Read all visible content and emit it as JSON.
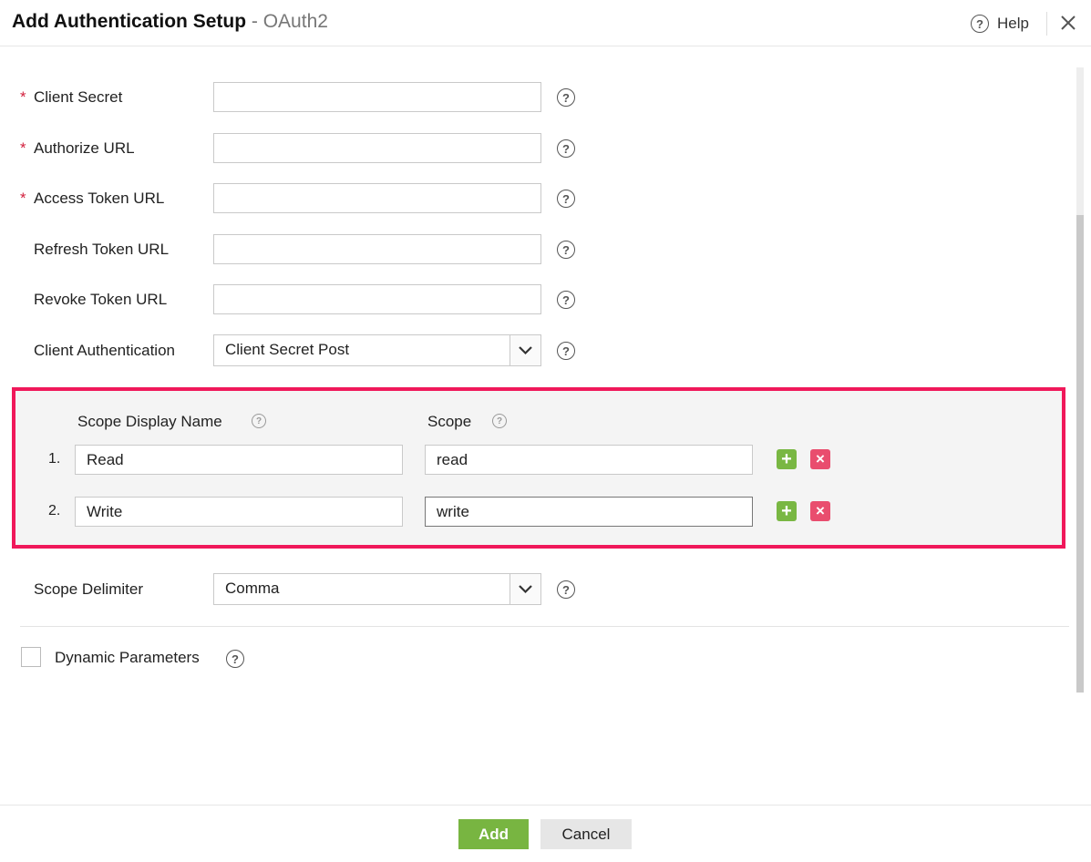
{
  "header": {
    "title": "Add Authentication Setup",
    "separator": " - ",
    "subtitle": "OAuth2",
    "help_label": "Help",
    "help_icon": "question-circle-icon",
    "close_icon": "close-icon"
  },
  "form": {
    "client_secret": {
      "label": "Client Secret",
      "required_mark": "*",
      "value": ""
    },
    "authorize_url": {
      "label": "Authorize URL",
      "required_mark": "*",
      "value": ""
    },
    "access_token_url": {
      "label": "Access Token URL",
      "required_mark": "*",
      "value": ""
    },
    "refresh_token_url": {
      "label": "Refresh Token URL",
      "value": ""
    },
    "revoke_token_url": {
      "label": "Revoke Token URL",
      "value": ""
    },
    "client_authentication": {
      "label": "Client Authentication",
      "selected": "Client Secret Post"
    },
    "scope_delimiter": {
      "label": "Scope Delimiter",
      "selected": "Comma"
    },
    "dynamic_parameters": {
      "label": "Dynamic Parameters",
      "checked": false
    }
  },
  "scopes": {
    "display_name_header": "Scope Display Name",
    "scope_header": "Scope",
    "rows": [
      {
        "index": "1.",
        "display_name": "Read",
        "scope": "read"
      },
      {
        "index": "2.",
        "display_name": "Write",
        "scope": "write"
      }
    ],
    "highlight_color": "#f0185a"
  },
  "footer": {
    "add_label": "Add",
    "cancel_label": "Cancel"
  },
  "colors": {
    "accent_green": "#78b541",
    "delete_red": "#e94d6e",
    "required_red": "#d21f3c"
  }
}
